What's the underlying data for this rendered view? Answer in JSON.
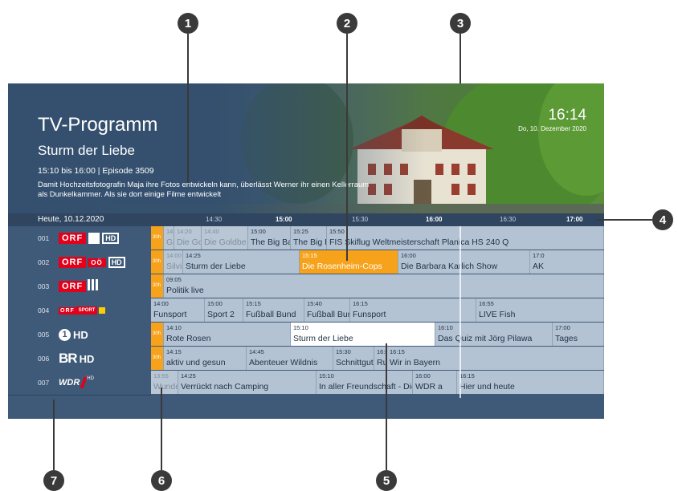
{
  "header": {
    "title": "TV-Programm",
    "show_title": "Sturm der Liebe",
    "time_info": "15:10 bis 16:00  |  Episode 3509",
    "description": "Damit Hochzeitsfotografin Maja ihre Fotos entwickeln kann, überlässt Werner ihr einen Kellerraum als Dunkelkammer. Als sie dort einige Filme entwickelt",
    "clock": "16:14",
    "date": "Do, 10. Dezember 2020"
  },
  "timebar": {
    "today": "Heute, 10.12.2020",
    "labels": [
      "14:30",
      "15:00",
      "15:30",
      "16:00",
      "16:30",
      "17:00"
    ]
  },
  "channels": [
    {
      "num": "001",
      "name": "ORF 1 HD"
    },
    {
      "num": "002",
      "name": "ORF OÖ HD"
    },
    {
      "num": "003",
      "name": "ORF III"
    },
    {
      "num": "004",
      "name": "ORF SPORT +"
    },
    {
      "num": "005",
      "name": "Das Erste HD"
    },
    {
      "num": "006",
      "name": "BR HD"
    },
    {
      "num": "007",
      "name": "WDR HD"
    }
  ],
  "logos": {
    "orf": "ORF",
    "hd": "HD",
    "oo": "OÖ",
    "sport": "SPORT",
    "ard": "1",
    "br": "BR",
    "wdr": "WDR",
    "wdr_hd": "HD"
  },
  "rows": [
    [
      {
        "time": "",
        "title": "30h",
        "style": "tag"
      },
      {
        "time": "14:1",
        "title": "Gra",
        "style": "past"
      },
      {
        "time": "14:20",
        "title": "Die Goldbe",
        "style": "past"
      },
      {
        "time": "14:40",
        "title": "Die Goldbe",
        "style": "past"
      },
      {
        "time": "15:00",
        "title": "The Big Bang",
        "style": ""
      },
      {
        "time": "15:25",
        "title": "The Big Ba",
        "style": ""
      },
      {
        "time": "15:50",
        "title": "FIS Skiflug Weltmeisterschaft Planica HS 240 Q",
        "style": ""
      }
    ],
    [
      {
        "time": "",
        "title": "30h",
        "style": "tag"
      },
      {
        "time": "14:00",
        "title": "Silvia",
        "style": "past"
      },
      {
        "time": "14:25",
        "title": "Sturm der Liebe",
        "style": ""
      },
      {
        "time": "15:15",
        "title": "Die Rosenheim-Cops",
        "style": "orange"
      },
      {
        "time": "16:00",
        "title": "Die Barbara Karlich Show",
        "style": ""
      },
      {
        "time": "17:0",
        "title": "AK",
        "style": ""
      }
    ],
    [
      {
        "time": "",
        "title": "30h",
        "style": "tag"
      },
      {
        "time": "09:05",
        "title": "Politik live",
        "style": ""
      }
    ],
    [
      {
        "time": "14:00",
        "title": "Funsport",
        "style": ""
      },
      {
        "time": "15:00",
        "title": "Sport 2",
        "style": ""
      },
      {
        "time": "15:15",
        "title": "Fußball Bund",
        "style": ""
      },
      {
        "time": "15:40",
        "title": "Fußball Bundesliga",
        "style": ""
      },
      {
        "time": "16:15",
        "title": "Funsport",
        "style": ""
      },
      {
        "time": "16:55",
        "title": "LIVE Fish",
        "style": ""
      }
    ],
    [
      {
        "time": "",
        "title": "30h",
        "style": "tag"
      },
      {
        "time": "14:10",
        "title": "Rote Rosen",
        "style": ""
      },
      {
        "time": "15:10",
        "title": "Sturm der Liebe",
        "style": "white"
      },
      {
        "time": "16:10",
        "title": "Das Quiz mit Jörg Pilawa",
        "style": ""
      },
      {
        "time": "17:00",
        "title": "Tages",
        "style": ""
      }
    ],
    [
      {
        "time": "",
        "title": "30h",
        "style": "tag"
      },
      {
        "time": "14:15",
        "title": "aktiv und gesun",
        "style": ""
      },
      {
        "time": "14:45",
        "title": "Abenteuer Wildnis",
        "style": ""
      },
      {
        "time": "15:30",
        "title": "Schnittgut. Alle",
        "style": ""
      },
      {
        "time": "16:00",
        "title": "Rundsc",
        "style": ""
      },
      {
        "time": "16:15",
        "title": "Wir in Bayern",
        "style": ""
      }
    ],
    [
      {
        "time": "13:55",
        "title": "Wunde",
        "style": "past"
      },
      {
        "time": "14:25",
        "title": "Verrückt nach Camping",
        "style": ""
      },
      {
        "time": "15:10",
        "title": "In aller Freundschaft - Die ju",
        "style": ""
      },
      {
        "time": "16:00",
        "title": "WDR a",
        "style": ""
      },
      {
        "time": "16:15",
        "title": "Hier und heute",
        "style": ""
      }
    ]
  ],
  "callouts": [
    "1",
    "2",
    "3",
    "4",
    "5",
    "6",
    "7"
  ]
}
